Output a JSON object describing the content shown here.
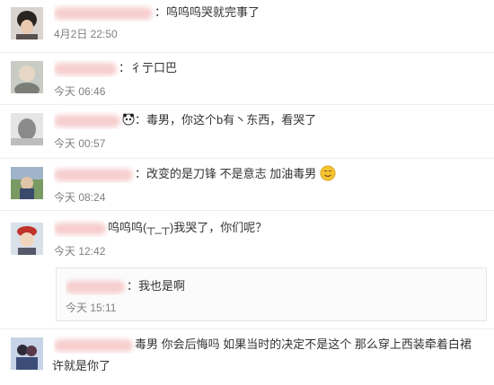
{
  "comments": [
    {
      "text": "呜呜呜哭就完事了",
      "time": "4月2日 22:50",
      "avatar": "avatar-dark-hair"
    },
    {
      "text": "彳亍口巴",
      "time": "今天 06:46",
      "avatar": "avatar-light"
    },
    {
      "text": "毒男，你这个b有丶东西，看哭了",
      "time": "今天 00:57",
      "avatar": "avatar-grey"
    },
    {
      "text": "改变的是刀锋 不是意志 加油毒男",
      "time": "今天 08:24",
      "avatar": "avatar-outdoor"
    },
    {
      "text": "呜呜呜(┬_┬)我哭了，你们呢？",
      "time": "今天 12:42",
      "avatar": "avatar-red-hat",
      "reply": {
        "text": "我也是啊",
        "time": "今天 15:11"
      }
    },
    {
      "text": "毒男  你会后悔吗  如果当时的决定不是这个  那么穿上西装牵着白裙",
      "text2": "许就是你了",
      "time": "",
      "avatar": "avatar-couple"
    }
  ],
  "icons": [
    "panda-emoji-icon",
    "smile-emoji-icon"
  ],
  "colors": {
    "time": "#808080",
    "text": "#333333",
    "name_blur": "#f6c9c9",
    "reply_bg": "#fbfbfb"
  }
}
